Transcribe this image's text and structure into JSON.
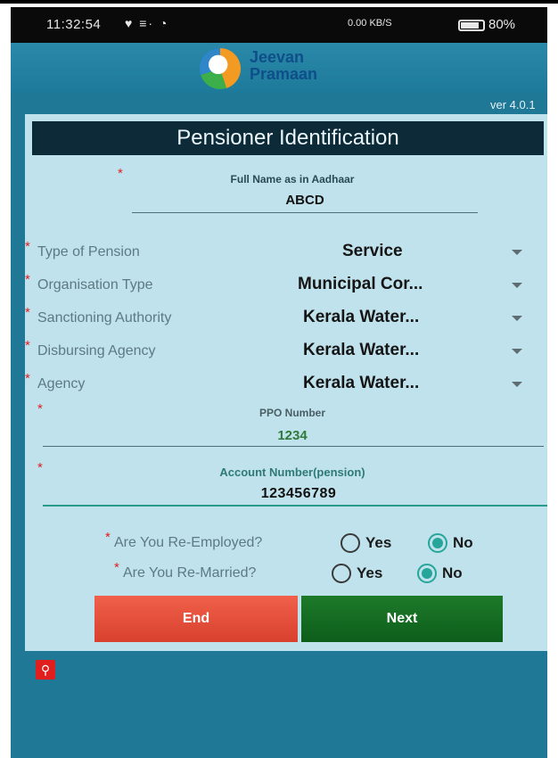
{
  "status_bar": {
    "time": "11:32:54",
    "notifications": "♥ ≡· ◔",
    "network": "0.00 KB/S",
    "battery": "80%"
  },
  "header": {
    "app_name_line1": "Jeevan",
    "app_name_line2": "Pramaan",
    "logo_icon": "jeevan-pramaan-logo"
  },
  "version": "ver 4.0.1",
  "form": {
    "title": "Pensioner Identification",
    "full_name": {
      "label": "Full Name as in Aadhaar",
      "value": "ABCD"
    },
    "selects": [
      {
        "label": "Type of Pension",
        "value": "Service"
      },
      {
        "label": "Organisation Type",
        "value": "Municipal Cor..."
      },
      {
        "label": "Sanctioning Authority",
        "value": "Kerala Water..."
      },
      {
        "label": "Disbursing Agency",
        "value": "Kerala Water..."
      },
      {
        "label": "Agency",
        "value": "Kerala Water..."
      }
    ],
    "ppo": {
      "label": "PPO Number",
      "value": "1234"
    },
    "account": {
      "label": "Account Number(pension)",
      "value": "123456789"
    },
    "re_employed": {
      "question": "Are You Re-Employed?",
      "yes": "Yes",
      "no": "No",
      "selected": "No"
    },
    "re_married": {
      "question": "Are You Re-Married?",
      "yes": "Yes",
      "no": "No",
      "selected": "No"
    },
    "required_marker": "*"
  },
  "buttons": {
    "end": "End",
    "next": "Next"
  },
  "colors": {
    "background": "#1e7896",
    "card": "#bfe2ec",
    "title_bar": "#0c2a38",
    "required": "#e02020",
    "radio_selected": "#26a69a",
    "end_button": "#e0513b",
    "next_button": "#14682a"
  },
  "icons": {
    "usb": "usb-icon",
    "caret": "chevron-down-icon"
  }
}
